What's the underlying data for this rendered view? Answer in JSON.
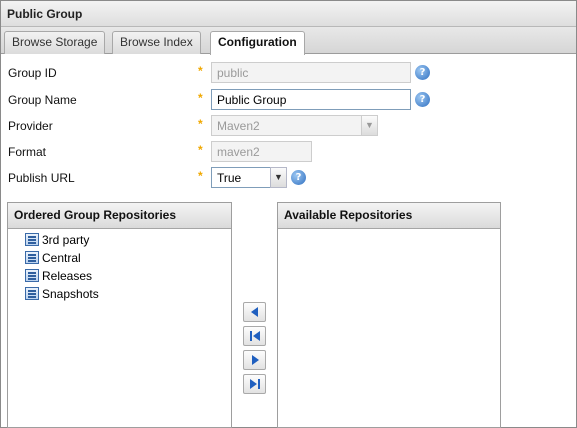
{
  "window": {
    "title": "Public Group"
  },
  "tabs": [
    {
      "label": "Browse Storage"
    },
    {
      "label": "Browse Index"
    },
    {
      "label": "Configuration"
    }
  ],
  "form": {
    "group_id": {
      "label": "Group ID",
      "value": "public"
    },
    "group_name": {
      "label": "Group Name",
      "value": "Public Group"
    },
    "provider": {
      "label": "Provider",
      "value": "Maven2"
    },
    "format": {
      "label": "Format",
      "value": "maven2"
    },
    "publish_url": {
      "label": "Publish URL",
      "value": "True"
    },
    "required_marker": "*",
    "help_glyph": "?"
  },
  "ordered_group": {
    "header": "Ordered Group Repositories",
    "items": [
      "3rd party",
      "Central",
      "Releases",
      "Snapshots"
    ]
  },
  "available": {
    "header": "Available Repositories",
    "items": []
  },
  "colors": {
    "required_star": "#f0a800",
    "help_icon": "#2f6fc0",
    "mover_arrow": "#1f5fbf"
  },
  "icons": {
    "combo_trigger": "chevron-down-icon",
    "help": "help-icon",
    "repository": "repository-icon",
    "move_left": "arrow-left-icon",
    "move_first": "arrow-first-icon",
    "move_right": "arrow-right-icon",
    "move_last": "arrow-last-icon"
  }
}
